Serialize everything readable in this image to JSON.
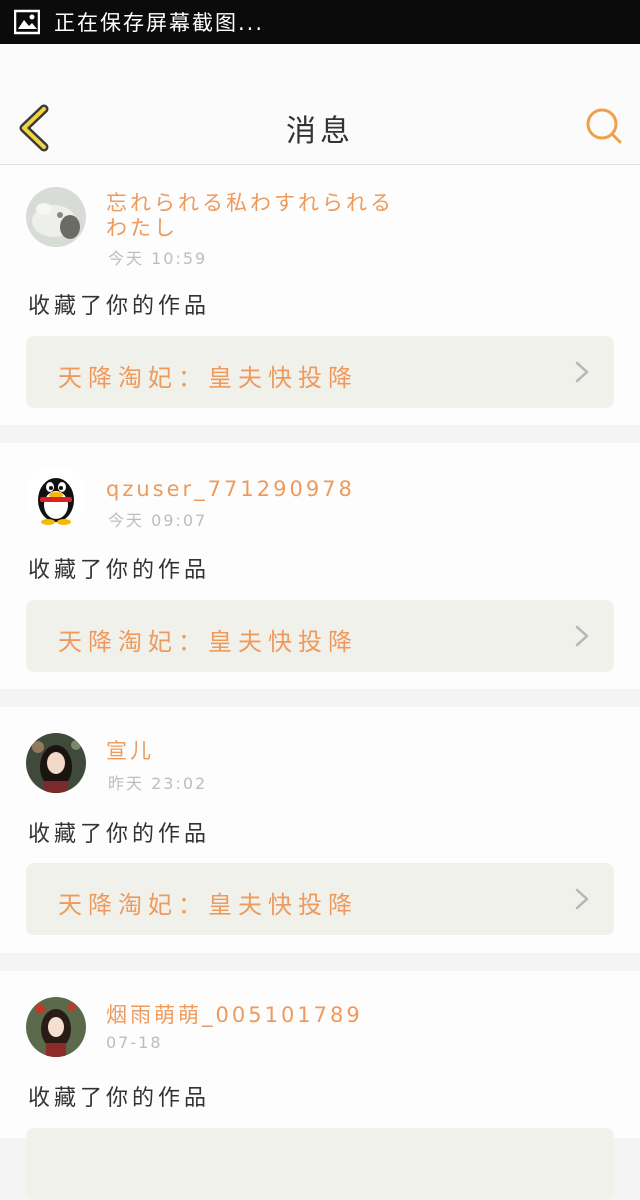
{
  "status_bar": {
    "text": "正在保存屏幕截图...",
    "icon": "image-icon"
  },
  "header": {
    "title": "消息",
    "back_icon": "chevron-left-icon",
    "search_icon": "search-icon",
    "accent_color": "#f0a04b"
  },
  "notifications": [
    {
      "username": "忘れられる私わすれられるわたし",
      "time": "今天 10:59",
      "action": "收藏了你的作品",
      "work_title": "天降淘妃：皇夫快投降",
      "avatar": "cat-avatar"
    },
    {
      "username": "qzuser_771290978",
      "time": "今天 09:07",
      "action": "收藏了你的作品",
      "work_title": "天降淘妃：皇夫快投降",
      "avatar": "qq-penguin-avatar"
    },
    {
      "username": "宣儿",
      "time": "昨天 23:02",
      "action": "收藏了你的作品",
      "work_title": "天降淘妃：皇夫快投降",
      "avatar": "girl-avatar"
    },
    {
      "username": "烟雨萌萌_005101789",
      "time": "07-18",
      "action": "收藏了你的作品",
      "work_title": "",
      "avatar": "anime-girl-avatar"
    }
  ],
  "colors": {
    "username": "#ef9a5d",
    "time": "#bdbdbd",
    "work_card_bg": "#f1f1ec",
    "divider": "#f0f0f0"
  }
}
